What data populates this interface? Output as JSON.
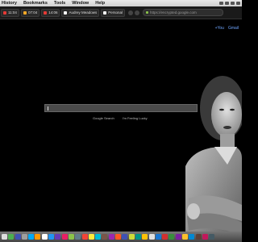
{
  "menubar": {
    "items": [
      "History",
      "Bookmarks",
      "Tools",
      "Window",
      "Help"
    ]
  },
  "tabs": [
    {
      "label": "11:04",
      "color": "#e53935"
    },
    {
      "label": "07:04",
      "color": "#f9a825"
    },
    {
      "label": "14:06",
      "color": "#e53935"
    },
    {
      "label": "Audrey Meadows",
      "color": "#ffffff"
    },
    {
      "label": "Personal",
      "color": "#ffffff"
    }
  ],
  "urlbar": {
    "url": "https://encrypted.google.com"
  },
  "google": {
    "links": [
      "+You",
      "Gmail"
    ],
    "search_value": "",
    "search_button": "Google Search",
    "lucky_button": "I'm Feeling Lucky"
  },
  "dock": {
    "icon_colors": [
      "#ddd",
      "#4caf50",
      "#3f51b5",
      "#9e9e9e",
      "#03a9f4",
      "#ff9800",
      "#ffffff",
      "#2196f3",
      "#673ab7",
      "#e91e63",
      "#8bc34a",
      "#607d8b",
      "#f44336",
      "#ffeb3b",
      "#00bcd4",
      "#795548",
      "#9c27b0",
      "#ff5722",
      "#3f51b5",
      "#cddc39",
      "#009688",
      "#ffc107",
      "#e0e0e0",
      "#1976d2",
      "#d32f2f",
      "#388e3c",
      "#7b1fa2",
      "#fbc02d",
      "#0288d1",
      "#5d4037",
      "#c2185b",
      "#455a64"
    ]
  }
}
